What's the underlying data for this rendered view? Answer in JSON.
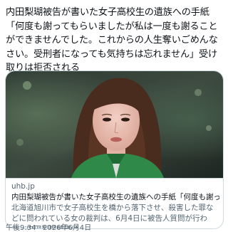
{
  "post": {
    "text": "内田梨瑚被告が書いた女子高校生の遺族への手紙「何度も謝ってもらいましたが私は一度も謝ることができませんでした。これからの人生奪いごめんなさい。受刑者になっても気持ちは忘れません」受け取りは拒否される"
  },
  "link_card": {
    "domain": "uhb.jp",
    "title": "内田梨瑚被告が書いた女子高校生の遺族への手紙「何度も謝ってもら...",
    "description": "北海道旭川市で女子高校生を橋から落下させ、殺害した罪などに問われている女の裁判は、6月4日に被告人質問が行われ、内田梨瑚被告は、..."
  },
  "meta": {
    "timestamp": "午後9:34 · 2026年6月4日"
  },
  "colors": {
    "text": "#0f1419",
    "secondary": "#536471",
    "border": "#cfd9de",
    "jacket": "#2f8a4a"
  }
}
